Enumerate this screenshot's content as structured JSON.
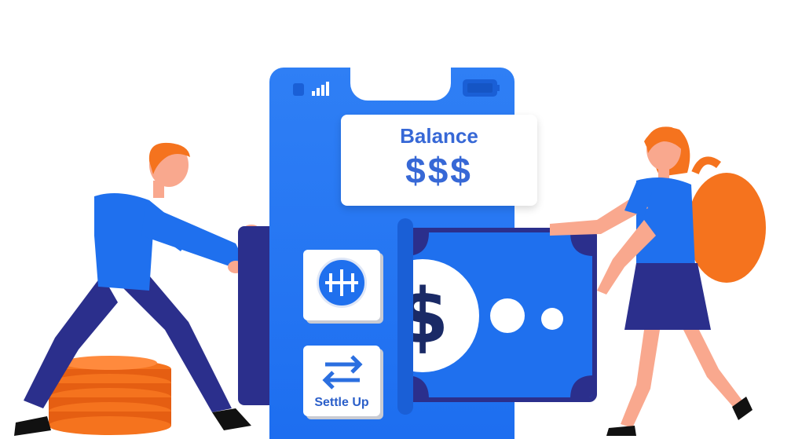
{
  "balance_card": {
    "label": "Balance",
    "amount": "$$$"
  },
  "actions": {
    "split_icon": "split-icon",
    "settle_icon": "arrows-swap-icon",
    "settle_label": "Settle Up"
  },
  "colors": {
    "primary_blue": "#1f70ee",
    "dark_navy": "#2b2f8c",
    "text_blue": "#3768d6",
    "orange": "#f5731e"
  }
}
